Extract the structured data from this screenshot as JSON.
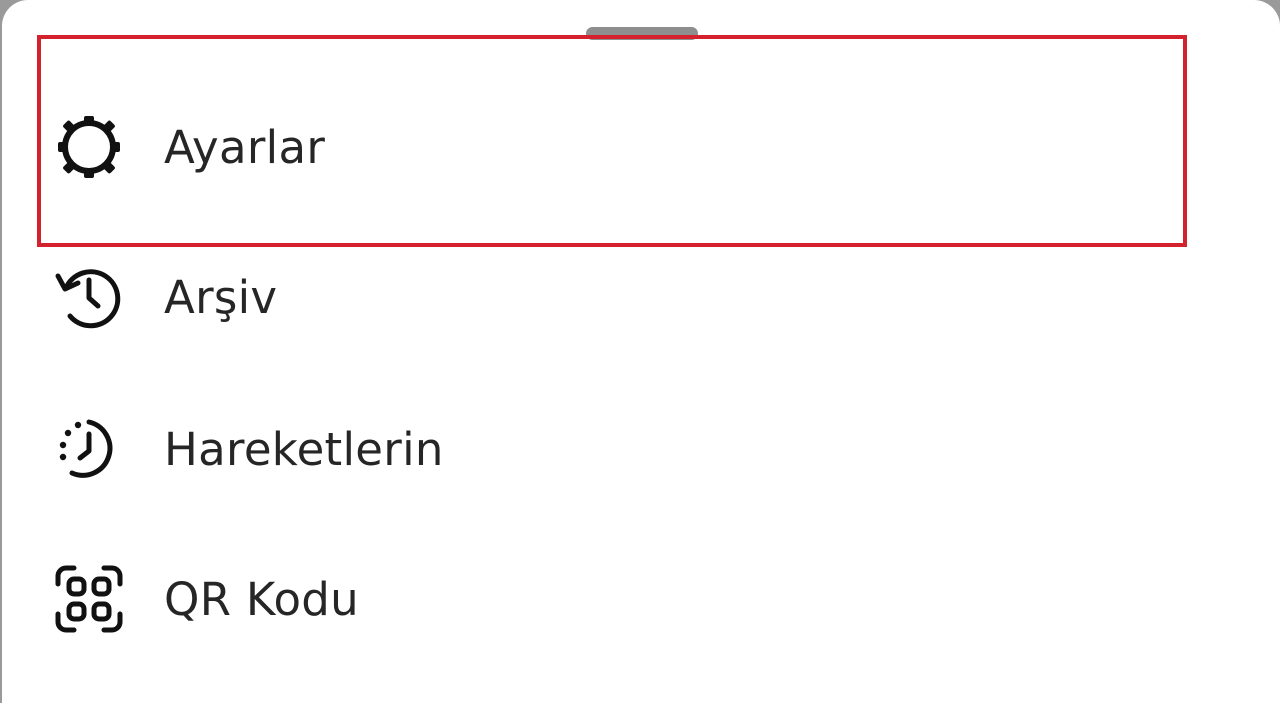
{
  "menu": {
    "items": [
      {
        "label": "Ayarlar",
        "icon": "settings-gear-icon"
      },
      {
        "label": "Arşiv",
        "icon": "archive-history-icon"
      },
      {
        "label": "Hareketlerin",
        "icon": "activity-clock-icon"
      },
      {
        "label": "QR Kodu",
        "icon": "qr-scan-icon"
      }
    ]
  },
  "colors": {
    "highlight": "#d3212d",
    "text": "#262626",
    "handle": "#8e8e8e"
  }
}
